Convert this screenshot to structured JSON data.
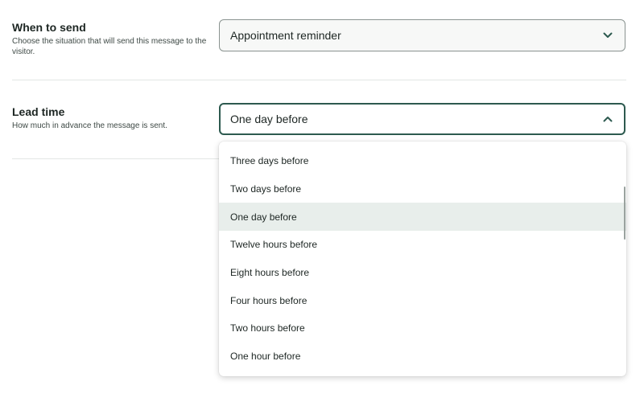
{
  "when_to_send": {
    "title": "When to send",
    "description": "Choose the situation that will send this message to the visitor.",
    "select_value": "Appointment reminder",
    "chevron_icon": "chevron-down-icon"
  },
  "lead_time": {
    "title": "Lead time",
    "description": "How much in advance the message is sent.",
    "select_value": "One day before",
    "chevron_icon": "chevron-up-icon",
    "options": [
      "Three days before",
      "Two days before",
      "One day before",
      "Twelve hours before",
      "Eight hours before",
      "Four hours before",
      "Two hours before",
      "One hour before"
    ],
    "selected_option": "One day before"
  },
  "colors": {
    "accent": "#2d5a4f",
    "selected_bg": "#e8eeeb",
    "text": "#1d2623"
  }
}
